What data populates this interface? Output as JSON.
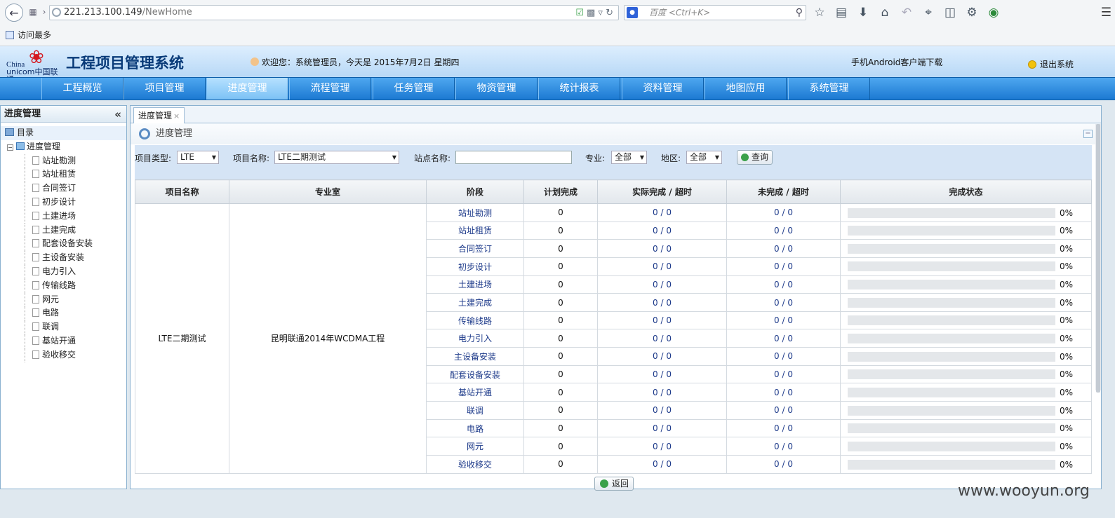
{
  "browser": {
    "url_host": "221.213.100.149",
    "url_path": "/NewHome",
    "search_placeholder": "百度 <Ctrl+K>",
    "favorites": "访问最多"
  },
  "header": {
    "logo_china": "China",
    "logo_unicom": "unicom中国联通",
    "title": "工程项目管理系统",
    "welcome": "欢迎您：系统管理员，今天是 2015年7月2日 星期四",
    "android": "手机Android客户端下载",
    "logout": "退出系统"
  },
  "menu": [
    "工程概览",
    "项目管理",
    "进度管理",
    "流程管理",
    "任务管理",
    "物资管理",
    "统计报表",
    "资料管理",
    "地图应用",
    "系统管理"
  ],
  "menu_active": "进度管理",
  "sidebar": {
    "title": "进度管理",
    "root": "目录",
    "group": "进度管理",
    "items": [
      "站址勘测",
      "站址租赁",
      "合同签订",
      "初步设计",
      "土建进场",
      "土建完成",
      "配套设备安装",
      "主设备安装",
      "电力引入",
      "传输线路",
      "网元",
      "电路",
      "联调",
      "基站开通",
      "验收移交"
    ]
  },
  "content": {
    "tab": "进度管理",
    "panel_title": "进度管理",
    "filter": {
      "type_label": "项目类型:",
      "type_value": "LTE",
      "name_label": "项目名称:",
      "name_value": "LTE二期测试",
      "site_label": "站点名称:",
      "site_value": "",
      "major_label": "专业:",
      "major_value": "全部",
      "region_label": "地区:",
      "region_value": "全部",
      "query": "查询"
    },
    "columns": [
      "项目名称",
      "专业室",
      "阶段",
      "计划完成",
      "实际完成 / 超时",
      "未完成 / 超时",
      "完成状态"
    ],
    "project_name": "LTE二期测试",
    "department": "昆明联通2014年WCDMA工程",
    "rows": [
      {
        "stage": "站址勘测",
        "plan": "0",
        "actual": "0 / 0",
        "pending": "0 / 0",
        "progress": 0,
        "pct": "0%"
      },
      {
        "stage": "站址租赁",
        "plan": "0",
        "actual": "0 / 0",
        "pending": "0 / 0",
        "progress": 0,
        "pct": "0%"
      },
      {
        "stage": "合同签订",
        "plan": "0",
        "actual": "0 / 0",
        "pending": "0 / 0",
        "progress": 0,
        "pct": "0%"
      },
      {
        "stage": "初步设计",
        "plan": "0",
        "actual": "0 / 0",
        "pending": "0 / 0",
        "progress": 0,
        "pct": "0%"
      },
      {
        "stage": "土建进场",
        "plan": "0",
        "actual": "0 / 0",
        "pending": "0 / 0",
        "progress": 0,
        "pct": "0%"
      },
      {
        "stage": "土建完成",
        "plan": "0",
        "actual": "0 / 0",
        "pending": "0 / 0",
        "progress": 0,
        "pct": "0%"
      },
      {
        "stage": "传输线路",
        "plan": "0",
        "actual": "0 / 0",
        "pending": "0 / 0",
        "progress": 0,
        "pct": "0%"
      },
      {
        "stage": "电力引入",
        "plan": "0",
        "actual": "0 / 0",
        "pending": "0 / 0",
        "progress": 0,
        "pct": "0%"
      },
      {
        "stage": "主设备安装",
        "plan": "0",
        "actual": "0 / 0",
        "pending": "0 / 0",
        "progress": 0,
        "pct": "0%"
      },
      {
        "stage": "配套设备安装",
        "plan": "0",
        "actual": "0 / 0",
        "pending": "0 / 0",
        "progress": 0,
        "pct": "0%"
      },
      {
        "stage": "基站开通",
        "plan": "0",
        "actual": "0 / 0",
        "pending": "0 / 0",
        "progress": 0,
        "pct": "0%"
      },
      {
        "stage": "联调",
        "plan": "0",
        "actual": "0 / 0",
        "pending": "0 / 0",
        "progress": 0,
        "pct": "0%"
      },
      {
        "stage": "电路",
        "plan": "0",
        "actual": "0 / 0",
        "pending": "0 / 0",
        "progress": 0,
        "pct": "0%"
      },
      {
        "stage": "网元",
        "plan": "0",
        "actual": "0 / 0",
        "pending": "0 / 0",
        "progress": 0,
        "pct": "0%"
      },
      {
        "stage": "验收移交",
        "plan": "0",
        "actual": "0 / 0",
        "pending": "0 / 0",
        "progress": 0,
        "pct": "0%"
      }
    ],
    "back": "返回"
  },
  "watermark": "www.wooyun.org",
  "colors": {
    "menu_bg": "#1c79d2",
    "header_bg": "#b7d8f6",
    "link": "#1d3a8a",
    "filter_bg": "#d5e4f5"
  }
}
